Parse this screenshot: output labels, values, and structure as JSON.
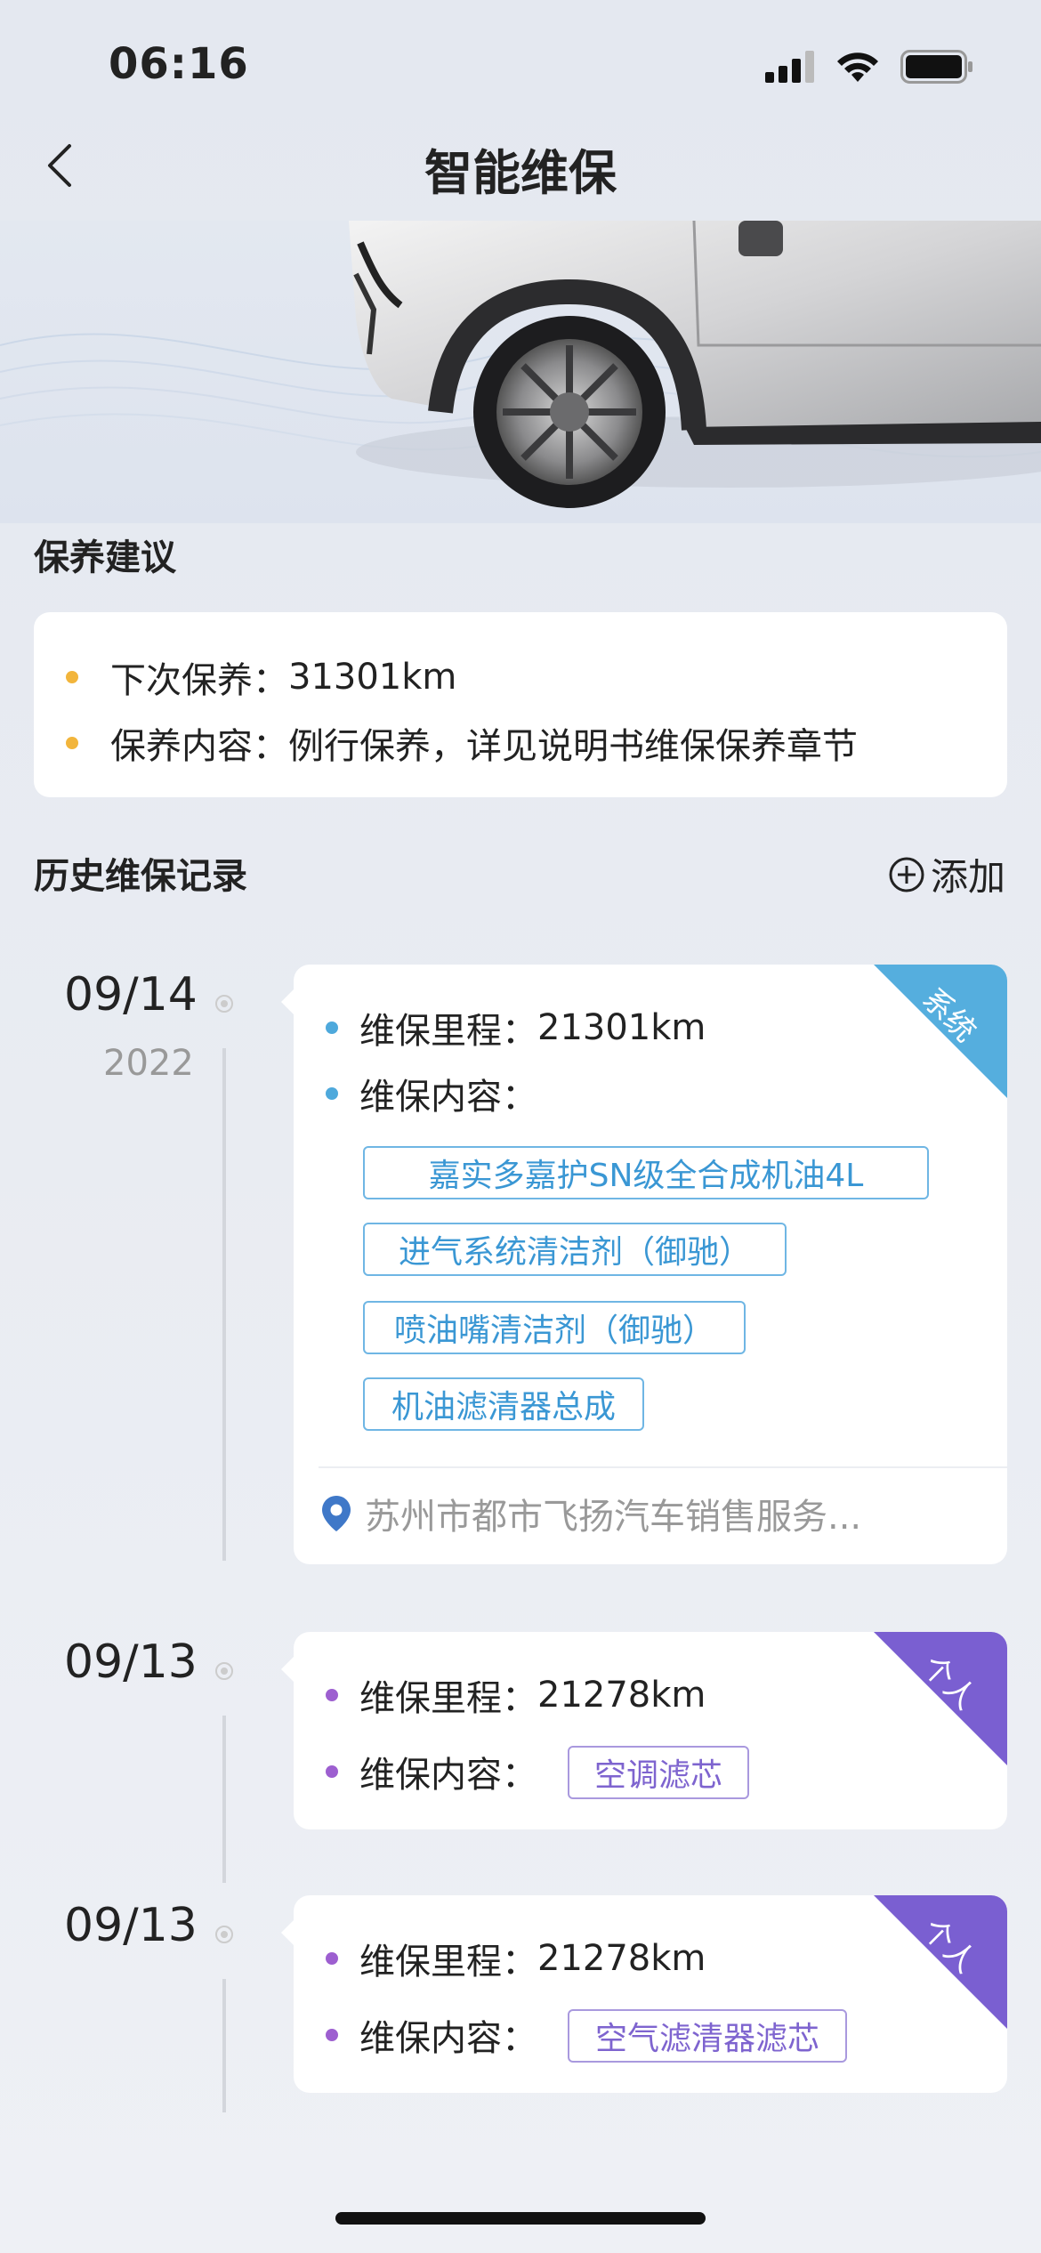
{
  "status_bar": {
    "time": "06:16"
  },
  "header": {
    "title": "智能维保"
  },
  "advice": {
    "section_title": "保养建议",
    "items": [
      {
        "label": "下次保养：",
        "value": "31301km"
      },
      {
        "label": "保养内容：",
        "value": "例行保养，详见说明书维保保养章节"
      }
    ],
    "dot_color": "#f2b53c"
  },
  "history": {
    "section_title": "历史维保记录",
    "add_label": "添加",
    "records": [
      {
        "date": "09/14",
        "year": "2022",
        "source_tag": "系统",
        "source_color": "#55aede",
        "mileage_label": "维保里程：",
        "mileage": "21301km",
        "content_label": "维保内容：",
        "items": [
          "嘉实多嘉护SN级全合成机油4L",
          "进气系统清洁剂（御驰）",
          "喷油嘴清洁剂（御驰）",
          "机油滤清器总成"
        ],
        "location": "苏州市都市飞扬汽车销售服务..."
      },
      {
        "date": "09/13",
        "source_tag": "个人",
        "source_color": "#7a5fd1",
        "mileage_label": "维保里程：",
        "mileage": "21278km",
        "content_label": "维保内容：",
        "items": [
          "空调滤芯"
        ]
      },
      {
        "date": "09/13",
        "source_tag": "个人",
        "source_color": "#7a5fd1",
        "mileage_label": "维保里程：",
        "mileage": "21278km",
        "content_label": "维保内容：",
        "items": [
          "空气滤清器滤芯"
        ]
      }
    ]
  },
  "icons": {
    "back": "chevron-left-icon",
    "signal": "signal-icon",
    "wifi": "wifi-icon",
    "battery": "battery-icon",
    "add": "plus-circle-icon",
    "location": "location-pin-icon"
  }
}
